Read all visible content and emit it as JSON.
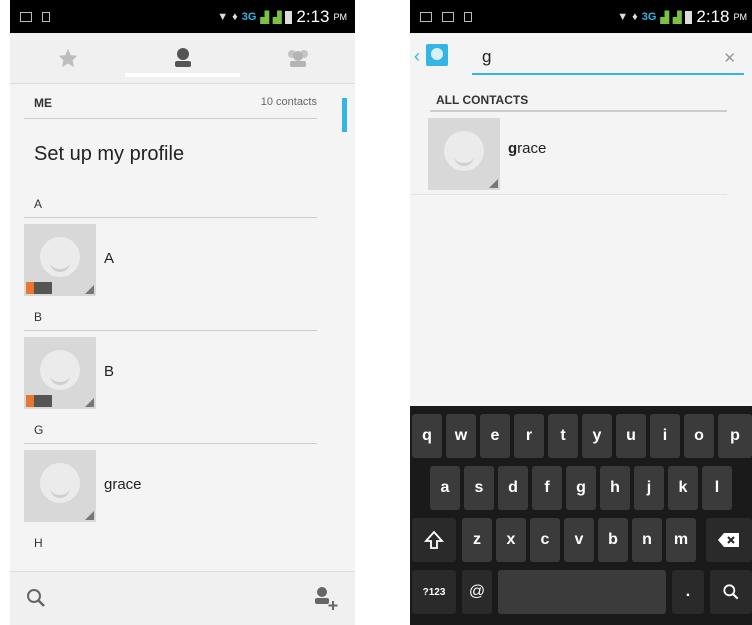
{
  "left": {
    "status": {
      "time": "2:13",
      "ampm": "PM",
      "network": "3G"
    },
    "tabs": [
      {
        "name": "favorites",
        "icon": "star-icon"
      },
      {
        "name": "contacts",
        "icon": "person-icon"
      },
      {
        "name": "groups",
        "icon": "group-icon"
      }
    ],
    "me_label": "ME",
    "contact_count": "10 contacts",
    "profile_text": "Set up my profile",
    "sections": [
      {
        "letter": "A",
        "name": "A"
      },
      {
        "letter": "B",
        "name": "B"
      },
      {
        "letter": "G",
        "name": "grace"
      },
      {
        "letter": "H"
      }
    ],
    "bottom": {
      "search_icon": "search-icon",
      "add_icon": "add-contact-icon"
    }
  },
  "right": {
    "status": {
      "time": "2:18",
      "ampm": "PM",
      "network": "3G"
    },
    "search_query": "g",
    "all_contacts_label": "ALL CONTACTS",
    "result": {
      "match": "g",
      "rest": "race"
    },
    "keyboard": {
      "row1": [
        "q",
        "w",
        "e",
        "r",
        "t",
        "y",
        "u",
        "i",
        "o",
        "p"
      ],
      "row2": [
        "a",
        "s",
        "d",
        "f",
        "g",
        "h",
        "j",
        "k",
        "l"
      ],
      "row3": [
        "z",
        "x",
        "c",
        "v",
        "b",
        "n",
        "m"
      ],
      "symbols_key": "?123",
      "at_key": "@",
      "period_key": "."
    }
  },
  "colors": {
    "accent": "#33b5e5",
    "sim_badge": "#e8772e",
    "keyboard_bg": "#1a1a1a",
    "key_bg": "#3b3b3b"
  }
}
